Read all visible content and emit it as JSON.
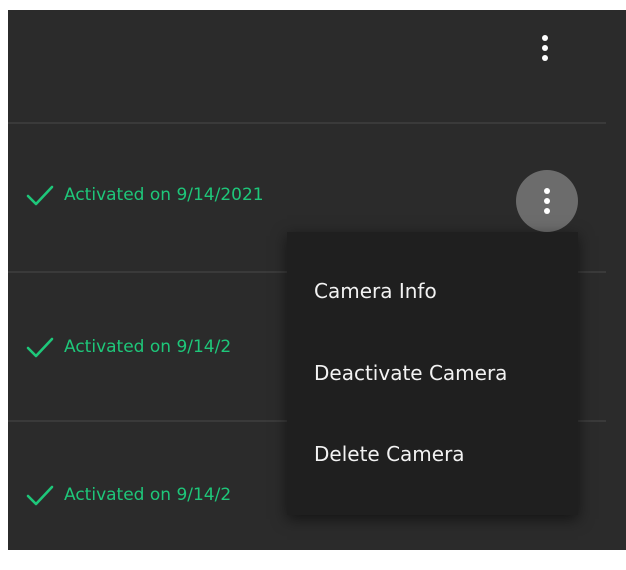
{
  "header": {
    "more_icon": "vertical-ellipsis-icon"
  },
  "rows": [
    {
      "status_text": "Activated on 9/14/2021",
      "icon": "checkmark-icon"
    },
    {
      "status_text": "Activated on 9/14/2",
      "icon": "checkmark-icon"
    },
    {
      "status_text": "Activated on 9/14/2",
      "icon": "checkmark-icon"
    }
  ],
  "context_menu": {
    "items": [
      {
        "label": "Camera Info"
      },
      {
        "label": "Deactivate Camera"
      },
      {
        "label": "Delete Camera"
      }
    ]
  },
  "colors": {
    "panel_background": "#2b2b2b",
    "menu_background": "#1f1f1f",
    "status_green": "#1ec77a",
    "active_button": "#6c6c6c"
  }
}
